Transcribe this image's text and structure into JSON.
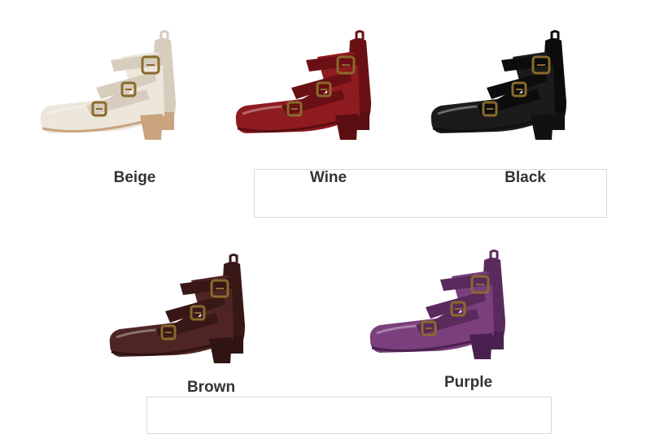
{
  "products": [
    {
      "id": "beige",
      "label": "Beige",
      "color": "#ece6db",
      "shade": "#d6cdbd",
      "sole": "#c9a47e"
    },
    {
      "id": "wine",
      "label": "Wine",
      "color": "#8e1b1f",
      "shade": "#6a1014",
      "sole": "#5a0e12"
    },
    {
      "id": "black",
      "label": "Black",
      "color": "#1b1b1b",
      "shade": "#0c0c0c",
      "sole": "#111111"
    },
    {
      "id": "brown",
      "label": "Brown",
      "color": "#4e2523",
      "shade": "#381817",
      "sole": "#2f1413"
    },
    {
      "id": "purple",
      "label": "Purple",
      "color": "#7a3f7c",
      "shade": "#5a2a5c",
      "sole": "#4a2050"
    }
  ],
  "buckle_color": "#8a6a2c"
}
